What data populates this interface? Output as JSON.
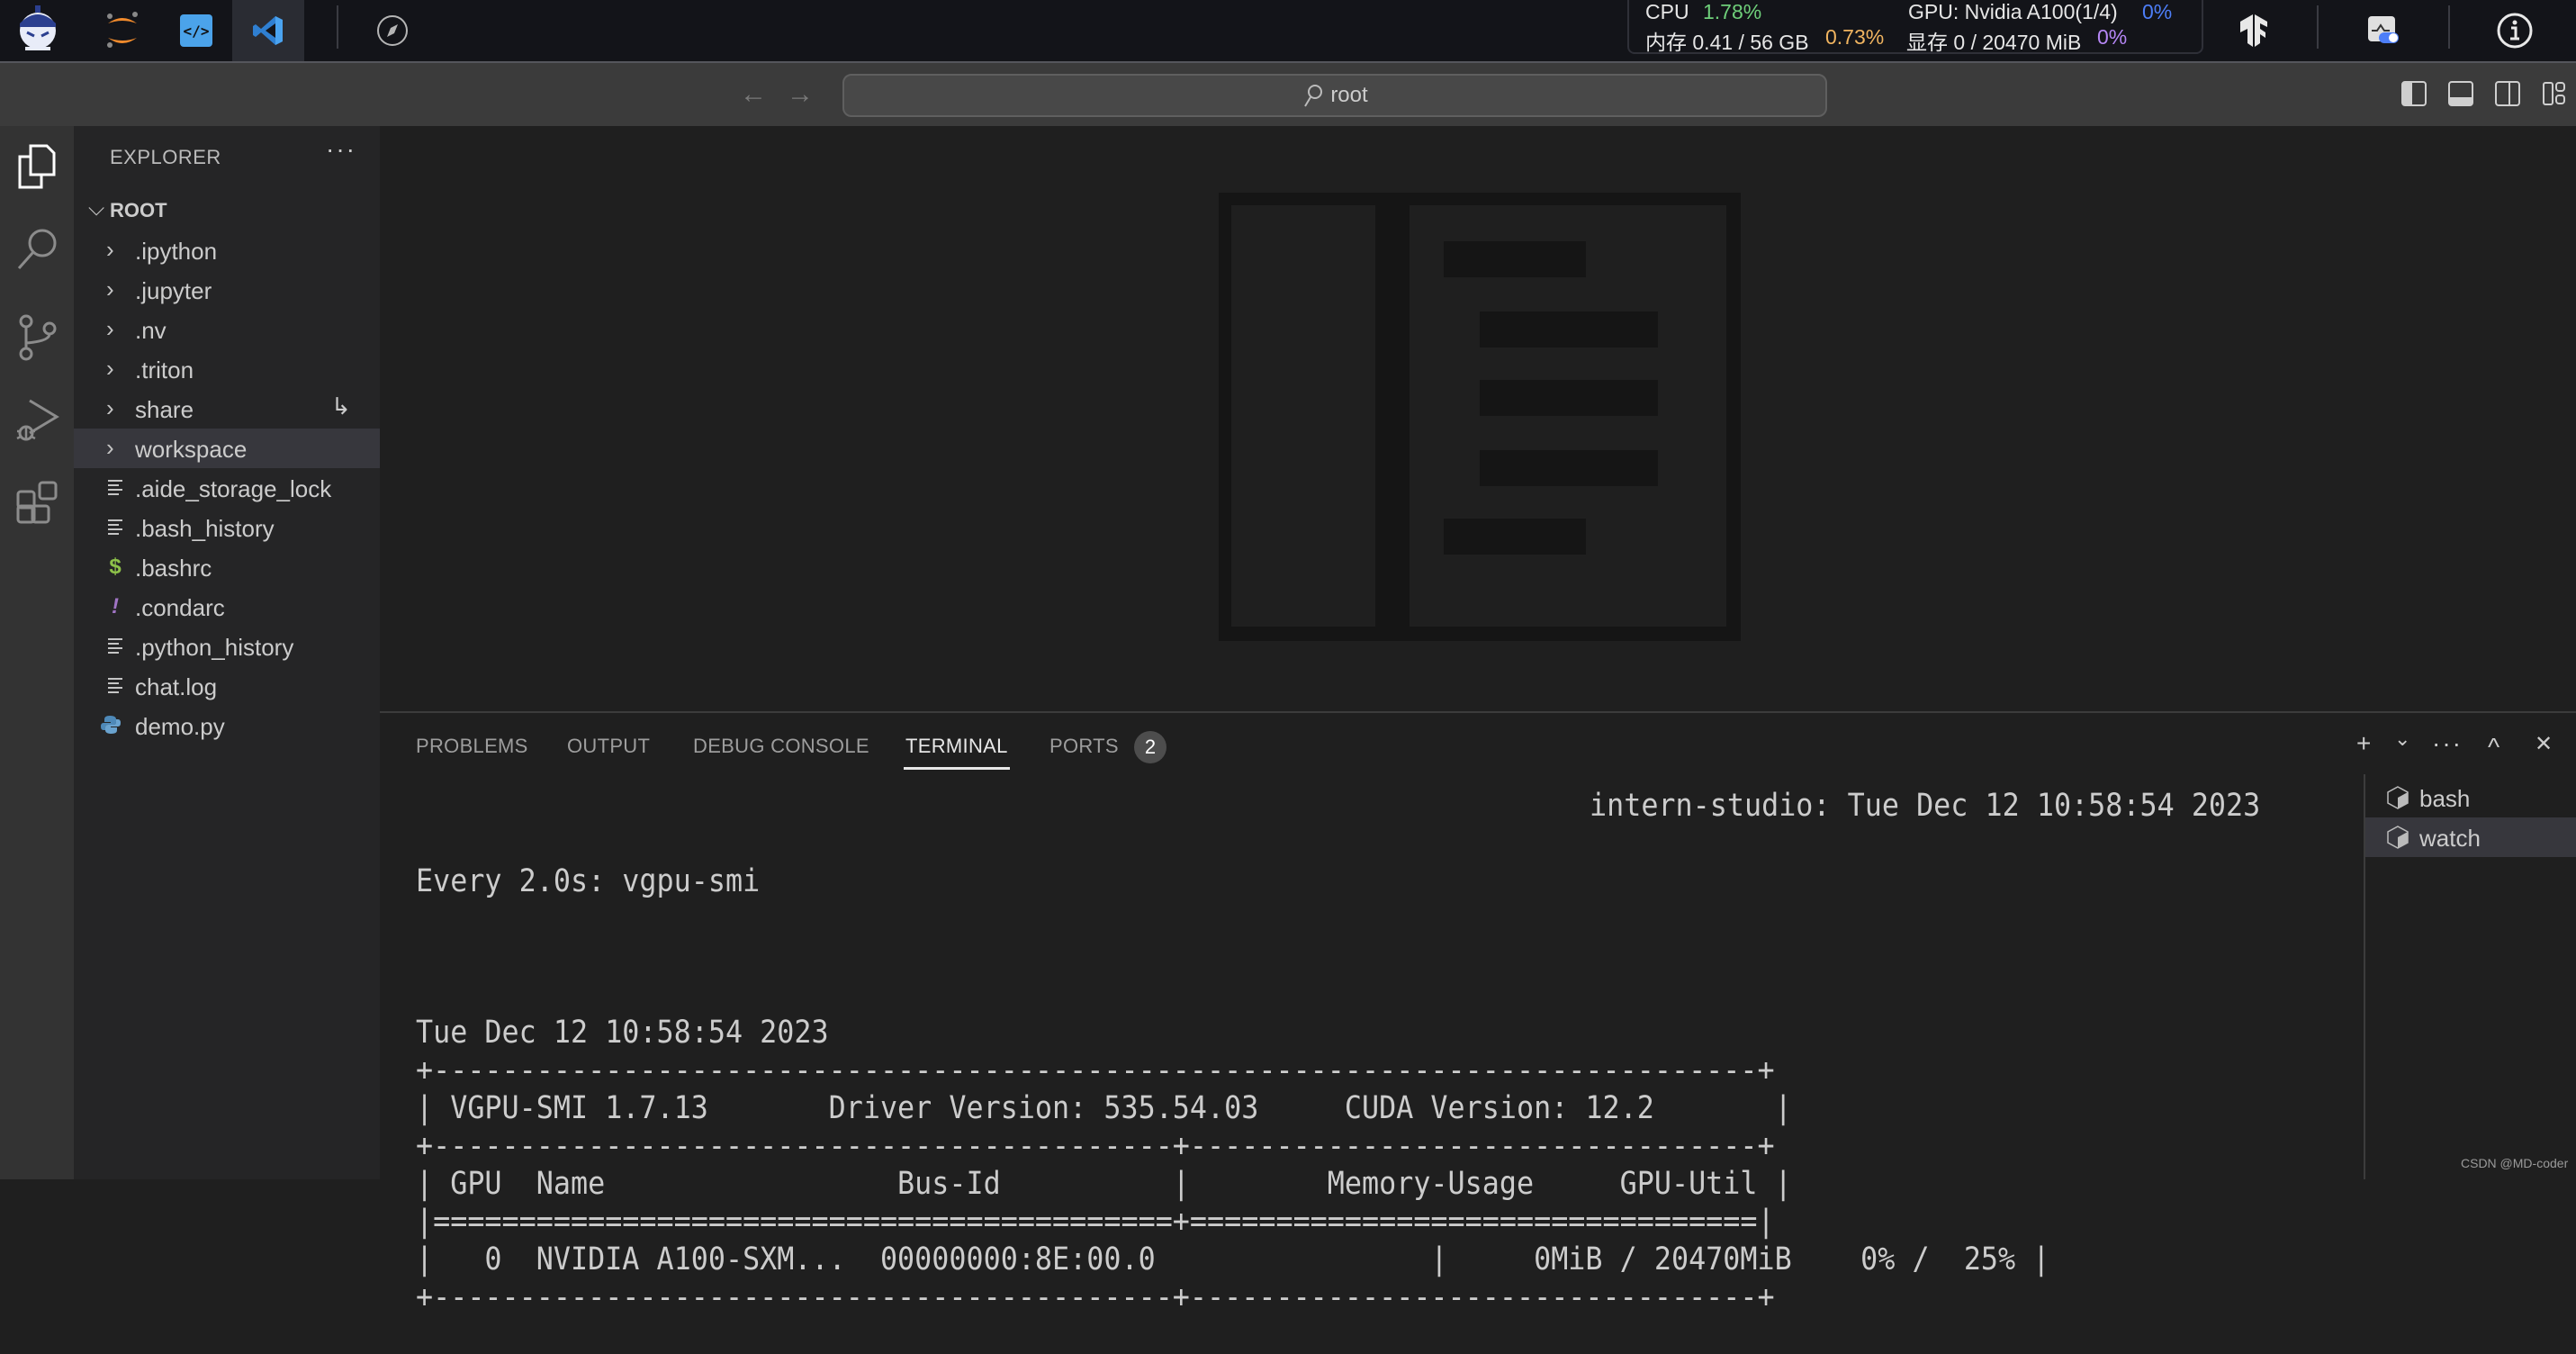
{
  "launcher": {
    "apps": [
      {
        "name": "InternStudio",
        "icon": "mascot-logo-icon"
      },
      {
        "name": "Jupyter",
        "icon": "jupyter-icon"
      },
      {
        "name": "Code Editor",
        "icon": "code-brackets-icon"
      },
      {
        "name": "VS Code",
        "icon": "vscode-icon",
        "active": true
      },
      {
        "name": "Browser",
        "icon": "compass-icon"
      }
    ],
    "status": {
      "cpu_label": "CPU",
      "cpu_value": "1.78%",
      "gpu_label": "GPU: Nvidia A100(1/4)",
      "gpu_value": "0%",
      "mem_label": "内存 0.41 / 56 GB",
      "mem_value": "0.73%",
      "vram_label": "显存 0 / 20470 MiB",
      "vram_value": "0%"
    },
    "colors": {
      "cpu": "#6fcf7a",
      "gpu": "#4d7ef7",
      "mem": "#f0b460",
      "vram": "#b586f5"
    },
    "right_icons": [
      "tensorflow-icon",
      "monitor-toggle-icon",
      "info-icon"
    ]
  },
  "titlebar": {
    "back_label": "←",
    "forward_label": "→",
    "search_text": "root",
    "layout_buttons": [
      "toggle-primary-sidebar",
      "toggle-panel",
      "toggle-secondary-sidebar",
      "customize-layout"
    ]
  },
  "activity_bar": [
    "explorer",
    "search",
    "source-control",
    "run-and-debug",
    "extensions"
  ],
  "explorer": {
    "title": "EXPLORER",
    "more": "···",
    "root_label": "ROOT",
    "items": [
      {
        "label": ".ipython",
        "type": "folder"
      },
      {
        "label": ".jupyter",
        "type": "folder"
      },
      {
        "label": ".nv",
        "type": "folder"
      },
      {
        "label": ".triton",
        "type": "folder"
      },
      {
        "label": "share",
        "type": "folder",
        "badge": "↳"
      },
      {
        "label": "workspace",
        "type": "folder",
        "hover": true
      },
      {
        "label": ".aide_storage_lock",
        "type": "file",
        "icon": "lines"
      },
      {
        "label": ".bash_history",
        "type": "file",
        "icon": "lines"
      },
      {
        "label": ".bashrc",
        "type": "file",
        "icon": "dollar"
      },
      {
        "label": ".condarc",
        "type": "file",
        "icon": "exclamation"
      },
      {
        "label": ".python_history",
        "type": "file",
        "icon": "lines"
      },
      {
        "label": "chat.log",
        "type": "file",
        "icon": "lines"
      },
      {
        "label": "demo.py",
        "type": "file",
        "icon": "python"
      }
    ]
  },
  "panel": {
    "tabs": [
      {
        "label": "PROBLEMS"
      },
      {
        "label": "OUTPUT"
      },
      {
        "label": "DEBUG CONSOLE"
      },
      {
        "label": "TERMINAL",
        "active": true
      },
      {
        "label": "PORTS",
        "badge": "2"
      }
    ],
    "actions": {
      "new": "+",
      "dropdown": "⌄",
      "more": "···",
      "maximize": "^",
      "close": "✕"
    },
    "terminal": {
      "header_left": "Every 2.0s: vgpu-smi",
      "header_right": "intern-studio: Tue Dec 12 10:58:54 2023",
      "lines": [
        "",
        "Tue Dec 12 10:58:54 2023",
        "+-----------------------------------------------------------------------------+",
        "| VGPU-SMI 1.7.13       Driver Version: 535.54.03     CUDA Version: 12.2       |",
        "+-------------------------------------------+---------------------------------+",
        "| GPU  Name                 Bus-Id          |        Memory-Usage     GPU-Util |",
        "|===========================================+=================================|",
        "|   0  NVIDIA A100-SXM...  00000000:8E:00.0                |     0MiB / 20470MiB    0% /  25% |",
        "+-------------------------------------------+---------------------------------+"
      ]
    },
    "terminal_list": [
      {
        "label": "bash"
      },
      {
        "label": "watch",
        "selected": true
      }
    ]
  },
  "watermark": "CSDN @MD-coder"
}
